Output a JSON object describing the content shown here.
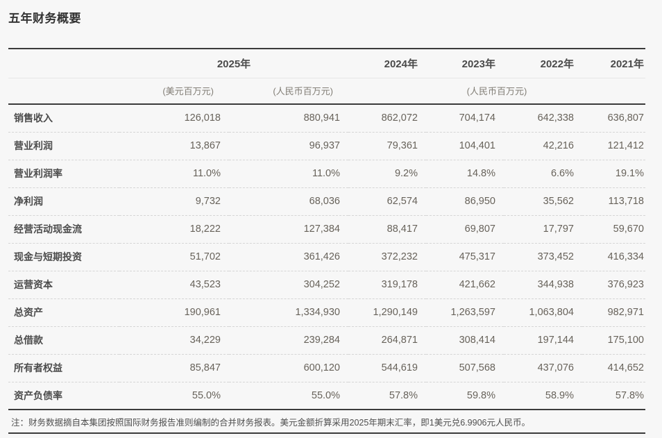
{
  "page": {
    "title": "五年财务概要",
    "background_color": "#f7f7f7",
    "rule_color": "#3b3b3b",
    "number_color": "#67625a"
  },
  "table": {
    "year_headers": [
      "2025年",
      "2024年",
      "2023年",
      "2022年",
      "2021年"
    ],
    "unit_headers": [
      "(美元百万元)",
      "(人民币百万元)",
      "(人民币百万元)"
    ],
    "rows": [
      {
        "label": "销售收入",
        "values": [
          "126,018",
          "880,941",
          "862,072",
          "704,174",
          "642,338",
          "636,807"
        ]
      },
      {
        "label": "营业利润",
        "values": [
          "13,867",
          "96,937",
          "79,361",
          "104,401",
          "42,216",
          "121,412"
        ]
      },
      {
        "label": "营业利润率",
        "values": [
          "11.0%",
          "11.0%",
          "9.2%",
          "14.8%",
          "6.6%",
          "19.1%"
        ]
      },
      {
        "label": "净利润",
        "values": [
          "9,732",
          "68,036",
          "62,574",
          "86,950",
          "35,562",
          "113,718"
        ]
      },
      {
        "label": "经营活动现金流",
        "values": [
          "18,222",
          "127,384",
          "88,417",
          "69,807",
          "17,797",
          "59,670"
        ]
      },
      {
        "label": "现金与短期投资",
        "values": [
          "51,702",
          "361,426",
          "372,232",
          "475,317",
          "373,452",
          "416,334"
        ]
      },
      {
        "label": "运营资本",
        "values": [
          "43,523",
          "304,252",
          "319,178",
          "421,662",
          "344,938",
          "376,923"
        ]
      },
      {
        "label": "总资产",
        "values": [
          "190,961",
          "1,334,930",
          "1,290,149",
          "1,263,597",
          "1,063,804",
          "982,971"
        ]
      },
      {
        "label": "总借款",
        "values": [
          "34,229",
          "239,284",
          "264,871",
          "308,414",
          "197,144",
          "175,100"
        ]
      },
      {
        "label": "所有者权益",
        "values": [
          "85,847",
          "600,120",
          "544,619",
          "507,568",
          "437,076",
          "414,652"
        ]
      },
      {
        "label": "资产负债率",
        "values": [
          "55.0%",
          "55.0%",
          "57.8%",
          "59.8%",
          "58.9%",
          "57.8%"
        ]
      }
    ],
    "footnote": "注：财务数据摘自本集团按照国际财务报告准则编制的合并财务报表。美元金额折算采用2025年期末汇率，即1美元兑6.9906元人民币。"
  }
}
